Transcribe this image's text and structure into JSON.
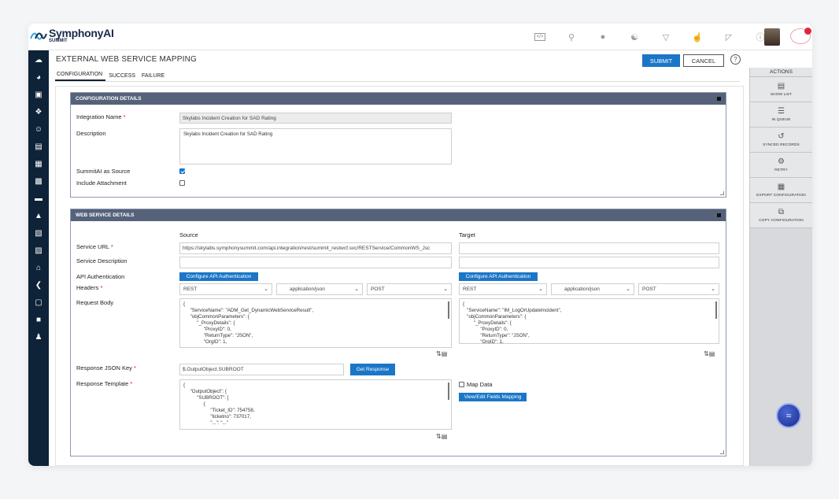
{
  "brand": {
    "name": "SymphonyAI",
    "sub": "SUMMIT"
  },
  "topbar": {
    "icons": [
      "code-icon",
      "search-icon",
      "globe-icon",
      "users-icon",
      "bell-icon",
      "thumbs-up-icon",
      "cart-icon",
      "help-icon"
    ]
  },
  "page": {
    "title": "EXTERNAL WEB SERVICE MAPPING",
    "submit": "SUBMIT",
    "cancel": "CANCEL",
    "help": "?"
  },
  "tabs": [
    "CONFIGURATION",
    "SUCCESS",
    "FAILURE"
  ],
  "config": {
    "header": "CONFIGURATION DETAILS",
    "integration_name_label": "Integration Name",
    "integration_name_value": "Skylabs Incident Creation for SAD Rating",
    "description_label": "Description",
    "description_value": "Skylabs Incident Creation for SAD Rating",
    "summitai_source_label": "SummitAI as Source",
    "summitai_source_checked": true,
    "include_attachment_label": "Include Attachment",
    "include_attachment_checked": false
  },
  "ws": {
    "header": "WEB SERVICE DETAILS",
    "source_label": "Source",
    "target_label": "Target",
    "service_url_label": "Service URL",
    "service_url_source": "https://skylabs.symphonysummit.com/api.integration/rest/summit_restwcf.svc/RESTService/CommonWS_Jsc",
    "service_url_target": "",
    "service_desc_label": "Service Description",
    "api_auth_label": "API Authentication",
    "configure_api_btn": "Configure API Authentication",
    "headers_label": "Headers",
    "source_headers": [
      "REST",
      "application/json",
      "POST"
    ],
    "target_headers": [
      "REST",
      "application/json",
      "POST"
    ],
    "request_body_label": "Request Body",
    "request_body_source": "{\n     \"ServiceName\": \"ADM_Get_DynamicWebServiceResult\",\n     \"objCommonParameters\": {\n          \"_ProxyDetails\": {\n               \"ProxyID\": 0,\n               \"ReturnType\": \"JSON\",\n               \"OrgID\": 1,",
    "request_body_target": "{\n   \"ServiceName\": \"IM_LogOrUpdateIncident\",\n   \"objCommonParameters\": {\n        \"_ProxyDetails\": {\n             \"ProxyID\": 0,\n             \"ReturnType\": \"JSON\",\n             \"OrgID\": 1,",
    "response_json_key_label": "Response JSON Key",
    "response_json_key_value": "$.OutputObject.SUBROOT",
    "get_response_btn": "Get Response",
    "response_template_label": "Response Template",
    "response_template_value": "{\n     \"OutputObject\": {\n          \"SUBROOT\": [\n               {\n                    \"Ticket_ID\": 754758,\n                    \"ticketno\": 737017,\n                    \"...\": \"...\"",
    "map_data_label": "Map Data",
    "view_edit_btn": "View/Edit Fields Mapping"
  },
  "actions": {
    "header": "ACTIONS",
    "items": [
      {
        "label": "SHOW LIST",
        "icon": "list-doc-icon"
      },
      {
        "label": "IN QUEUE",
        "icon": "queue-icon"
      },
      {
        "label": "SYNCED RECORDS",
        "icon": "history-icon"
      },
      {
        "label": "RETRY",
        "icon": "retry-icon"
      },
      {
        "label": "EXPORT CONFIGURATION",
        "icon": "export-icon"
      },
      {
        "label": "COPY CONFIGURATION",
        "icon": "copy-icon"
      }
    ]
  },
  "colors": {
    "primary": "#1a76c7",
    "nav": "#0e2238",
    "section_header": "#55627a"
  }
}
